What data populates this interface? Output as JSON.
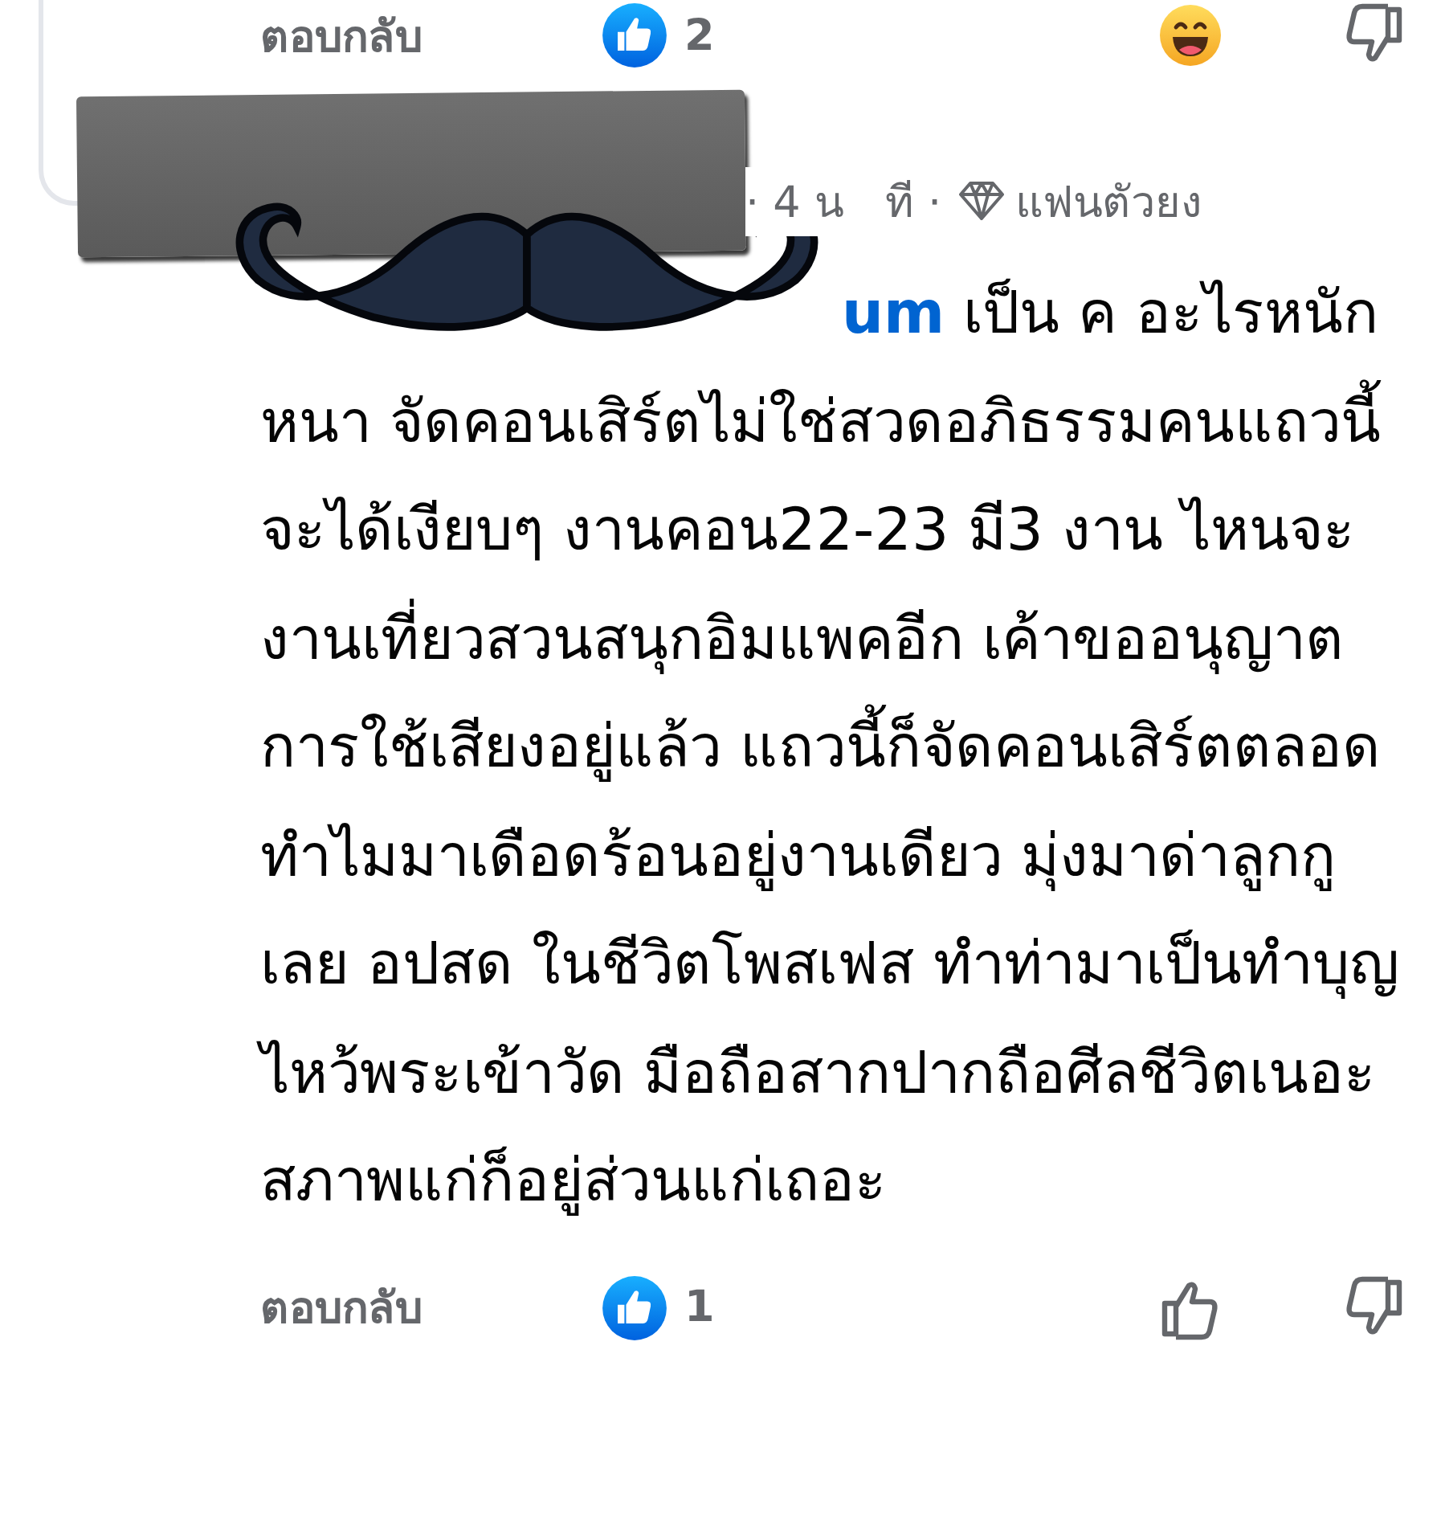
{
  "top_actions": {
    "reply": "ตอบกลับ",
    "like_count": "2",
    "buttons": [
      {
        "kind": "haha"
      },
      {
        "kind": "dislike"
      }
    ]
  },
  "comment": {
    "meta_parts": [
      "· 4 น",
      "ที ·"
    ],
    "badge": "แฟนตัวยง",
    "author_fragment": "um",
    "text": " เป็น ค อะไรหนักหนา จัดคอนเสิร์ตไม่ใช่สวดอภิธรรมคนแถวนี้ จะได้เงียบๆ งานคอน22-23 มี3 งาน ไหนจะงานเที่ยวสวนสนุกอิมแพคอีก เค้าขออนุญาตการใช้เสียงอยู่แล้ว แถวนี้ก็จัดคอนเสิร์ตตลอด ทำไมมาเดือดร้อนอยู่งานเดียว มุ่งมาด่าลูกกูเลย อปสด ในชีวิตโพสเฟส ทำท่ามาเป็นทำบุญไหว้พระเข้าวัด มือถือสากปากถือศีลชีวิตเนอะสภาพแก่ก็อยู่ส่วนแก่เถอะ"
  },
  "bottom_actions": {
    "reply": "ตอบกลับ",
    "like_count": "1",
    "buttons": [
      {
        "kind": "like"
      },
      {
        "kind": "dislike"
      }
    ]
  }
}
